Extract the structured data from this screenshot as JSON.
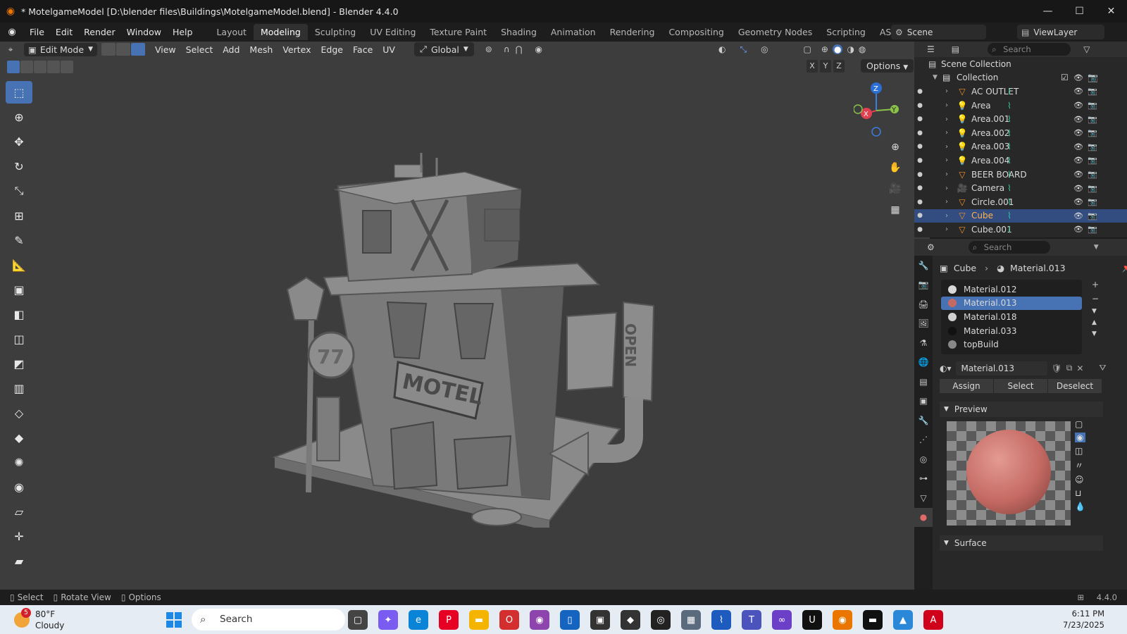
{
  "titlebar": {
    "title": "* MotelgameModel [D:\\blender files\\Buildings\\MotelgameModel.blend] - Blender 4.4.0",
    "minimize": "—",
    "maximize": "☐",
    "close": "✕"
  },
  "menubar": {
    "items": [
      "File",
      "Edit",
      "Render",
      "Window",
      "Help"
    ],
    "workspaces": [
      "Layout",
      "Modeling",
      "Sculpting",
      "UV Editing",
      "Texture Paint",
      "Shading",
      "Animation",
      "Rendering",
      "Compositing",
      "Geometry Nodes",
      "Scripting",
      "ASSESTS"
    ],
    "active_workspace": "Modeling",
    "scene": "Scene",
    "view_layer": "ViewLayer"
  },
  "viewport": {
    "mode": "Edit Mode",
    "menus": [
      "View",
      "Select",
      "Add",
      "Mesh",
      "Vertex",
      "Edge",
      "Face",
      "UV"
    ],
    "orientation": "Global",
    "axes": [
      "X",
      "Y",
      "Z"
    ],
    "options": "Options",
    "sign_motel": "MOTEL",
    "sign_open": "OPEN",
    "sign_number": "77",
    "gizmo_x": "X",
    "gizmo_y": "Y",
    "gizmo_z": "Z"
  },
  "outliner": {
    "search_placeholder": "Search",
    "scene_collection": "Scene Collection",
    "collection": "Collection",
    "rows": [
      {
        "name": "AC OUTLET",
        "icon": "mesh-icon",
        "selected": false
      },
      {
        "name": "Area",
        "icon": "light-icon",
        "selected": false
      },
      {
        "name": "Area.001",
        "icon": "light-icon",
        "selected": false
      },
      {
        "name": "Area.002",
        "icon": "light-icon",
        "selected": false
      },
      {
        "name": "Area.003",
        "icon": "light-icon",
        "selected": false
      },
      {
        "name": "Area.004",
        "icon": "light-icon",
        "selected": false
      },
      {
        "name": "BEER BOARD",
        "icon": "mesh-icon",
        "selected": false
      },
      {
        "name": "Camera",
        "icon": "camera-icon",
        "selected": false
      },
      {
        "name": "Circle.001",
        "icon": "mesh-icon",
        "selected": false
      },
      {
        "name": "Cube",
        "icon": "mesh-icon",
        "selected": true
      },
      {
        "name": "Cube.001",
        "icon": "mesh-icon",
        "selected": false
      }
    ]
  },
  "properties": {
    "search_placeholder": "Search",
    "breadcrumb_object": "Cube",
    "breadcrumb_material": "Material.013",
    "slots": [
      {
        "name": "Material.012",
        "color": "#d8d8d8",
        "selected": false
      },
      {
        "name": "Material.013",
        "color": "#c46a63",
        "selected": true
      },
      {
        "name": "Material.018",
        "color": "#d0d0d0",
        "selected": false
      },
      {
        "name": "Material.033",
        "color": "#111111",
        "selected": false
      },
      {
        "name": "topBuild",
        "color": "#888888",
        "selected": false
      }
    ],
    "material_field": "Material.013",
    "assign": "Assign",
    "select": "Select",
    "deselect": "Deselect",
    "preview": "Preview",
    "surface": "Surface",
    "preview_color": "#c46a63"
  },
  "statusbar": {
    "select": "Select",
    "rotate_view": "Rotate View",
    "options": "Options",
    "version": "4.4.0"
  },
  "taskbar": {
    "weather_badge": "5",
    "temperature": "80°F",
    "condition": "Cloudy",
    "search": "Search",
    "time": "6:11 PM",
    "date": "7/23/2025"
  }
}
